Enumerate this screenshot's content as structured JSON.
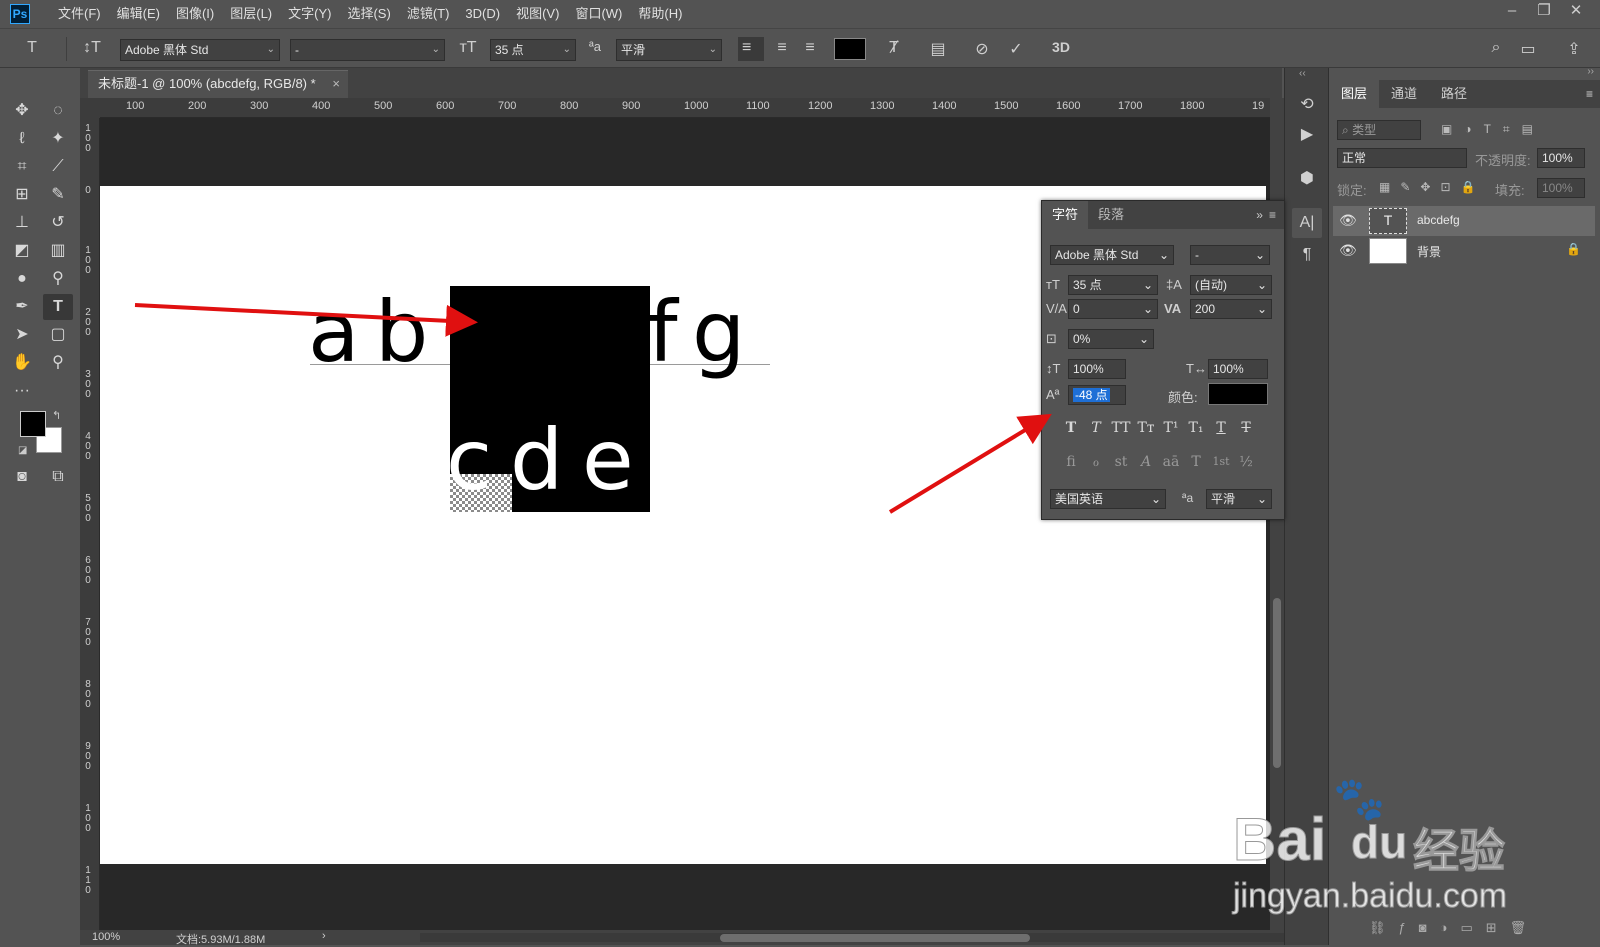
{
  "app": {
    "logo": "Ps"
  },
  "menu": [
    "文件(F)",
    "编辑(E)",
    "图像(I)",
    "图层(L)",
    "文字(Y)",
    "选择(S)",
    "滤镜(T)",
    "3D(D)",
    "视图(V)",
    "窗口(W)",
    "帮助(H)"
  ],
  "options": {
    "font_family": "Adobe 黑体 Std",
    "font_style": "-",
    "font_size": "35 点",
    "anti_alias": "平滑",
    "aa_glyph": "ªa",
    "toggle_3d": "3D",
    "text_color": "#000000"
  },
  "document": {
    "tab_title": "未标题-1 @ 100% (abcdefg, RGB/8) *",
    "ruler_ticks": [
      "100",
      "200",
      "300",
      "400",
      "500",
      "600",
      "700",
      "800",
      "900",
      "1000",
      "1100",
      "1200",
      "1300",
      "1400",
      "1500",
      "1600",
      "1700",
      "1800",
      "19"
    ],
    "vruler": [
      [
        "1",
        "0",
        "0"
      ],
      [
        "0"
      ],
      [
        "1",
        "0",
        "0"
      ],
      [
        "2",
        "0",
        "0"
      ],
      [
        "3",
        "0",
        "0"
      ],
      [
        "4",
        "0",
        "0"
      ],
      [
        "5",
        "0",
        "0"
      ],
      [
        "6",
        "0",
        "0"
      ],
      [
        "7",
        "0",
        "0"
      ],
      [
        "8",
        "0",
        "0"
      ],
      [
        "9",
        "0",
        "0"
      ],
      [
        "1",
        "0",
        "0"
      ],
      [
        "1",
        "1",
        "0"
      ]
    ],
    "text_top": [
      "a",
      "b",
      "f",
      "g"
    ],
    "text_bottom": [
      "c",
      "d",
      "e"
    ]
  },
  "status": {
    "zoom": "100%",
    "doc_size": "文档:5.93M/1.88M"
  },
  "character_panel": {
    "tabs": [
      "字符",
      "段落"
    ],
    "font_family": "Adobe 黑体 Std",
    "font_style": "-",
    "size": "35 点",
    "leading": "(自动)",
    "kerning": "0",
    "tracking": "200",
    "tsume": "0%",
    "vscale": "100%",
    "hscale": "100%",
    "baseline_shift": "-48 点",
    "color_label": "颜色:",
    "color": "#000000",
    "language": "美国英语",
    "aa_glyph": "ªa",
    "anti_alias": "平滑",
    "style_buttons": [
      "T",
      "T",
      "TT",
      "Tт",
      "T¹",
      "T₁",
      "T",
      "T"
    ],
    "opentype_buttons": [
      "fi",
      "ℴ",
      "st",
      "A",
      "aā",
      "T",
      "1st",
      "½"
    ]
  },
  "layers_panel": {
    "tabs": [
      "图层",
      "通道",
      "路径"
    ],
    "filter_placeholder": "类型",
    "blend_mode": "正常",
    "opacity_label": "不透明度:",
    "opacity": "100%",
    "lock_label": "锁定:",
    "fill_label": "填充:",
    "fill": "100%",
    "layers": [
      {
        "name": "abcdefg",
        "type": "text",
        "thumb_glyph": "T",
        "selected": true
      },
      {
        "name": "背景",
        "type": "background",
        "locked": true,
        "selected": false
      }
    ]
  },
  "watermark": {
    "brand": "Bai",
    "brand_tail": "du",
    "cn": "经验",
    "url": "jingyan.baidu.com"
  },
  "colors": {
    "arrow": "#e01010",
    "selection": "#1e6fd6",
    "panel": "#535353",
    "dark": "#424242"
  }
}
